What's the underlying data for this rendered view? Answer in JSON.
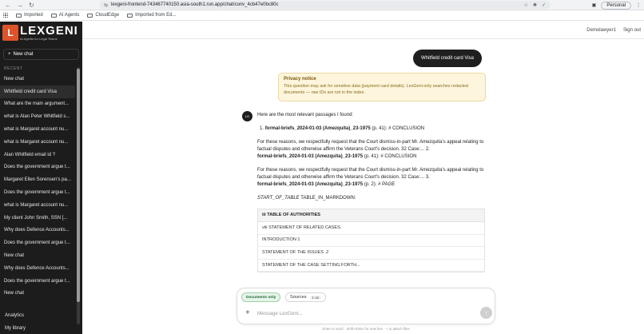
{
  "browser": {
    "url": "lexgeni-frontend-743467740150.asia-south1.run.app/chat/conv_4cb47e0bc80c",
    "profile": "Personal",
    "bookmarks": [
      "Imported",
      "AI Agents",
      "CloudEdge",
      "Imported from Ed..."
    ]
  },
  "sidebar": {
    "brand": "LEXGENI",
    "tagline": "AI Agents for Legal Teams",
    "new_chat": "New chat",
    "recent_label": "RECENT",
    "items": [
      "New chat",
      "Whitfield credit card Visa",
      "What are the main argument...",
      "what is Alan Peter Whitfield s...",
      "what is Margaret account nu...",
      "what is Margaret account nu...",
      "Alan Whitfield email id ?",
      "Does the government argue t...",
      "Margaret Ellen Sorensen's pa...",
      "Does the government argue t...",
      "what is Margaret account nu...",
      "My client John Smith, SSN [...",
      "Why does Defence Accounts...",
      "Does the government argue t...",
      "New chat",
      "Why does Defence Accounts...",
      "Does the government argue t...",
      "New chat"
    ],
    "footer": [
      "Analytics",
      "My library"
    ]
  },
  "topbar": {
    "user": "Demolawyer1",
    "signout": "Sign out"
  },
  "chat": {
    "user_message": "Whitfield credit card Visa",
    "privacy_title": "Privacy notice",
    "privacy_body": "This question may ask for sensitive data (payment card details). LexGeni only searches redacted documents — raw IDs are not in the index.",
    "avatar": "LG",
    "intro": "Here are the most relevant passages I found:",
    "ref1_num": "1.",
    "ref1_cite": "formal-briefs_2024-01-03 (Amezquita)_23-1975",
    "ref1_tail": " (p. 41): # CONCLUSION",
    "para1": "For these reasons, we respectfully request that the Court dismiss-in-part Mr. Amezquita's appeal relating to factual disputes and otherwise affirm the Veterans Court's decision. 32 Case:... 2.",
    "ref2_cite": "formal-briefs_2024-01-03 (Amezquita)_23-1975",
    "ref2_tail": " (p. 41): # CONCLUSION",
    "para2": "For these reasons, we respectfully request that the Court dismiss-in-part Mr. Amezquita's appeal relating to factual disputes and otherwise affirm the Veterans Court's decision. 32 Case:... 3.",
    "ref3_cite": "formal-briefs_2024-01-03 (Amezquita)_23-1975",
    "ref3_tail": " (p. 2): # PAGE",
    "table_marker_italic": "START_OF_TABLE",
    "table_marker_rest": " TABLE_IN_MARKDOWN:",
    "table_head": "iii TABLE OF AUTHORITIES",
    "table_rows": [
      "viii STATEMENT OF RELATED CASES.",
      "INTRODUCTION 1",
      "STATEMENT OF THE ISSUES .2",
      "STATEMENT OF THE CASE SETTING FORTH..."
    ]
  },
  "composer": {
    "docs_only": "Documents only",
    "sources": "Sources",
    "sources_badge": "1 on",
    "placeholder": "Message LexGeni...",
    "hint": "Enter to send · Shift+Enter for new line · + to attach files"
  },
  "colors": {
    "brand": "#e0532a",
    "sidebar_bg": "#1c1c1c",
    "privacy_bg": "#fdf6dc"
  }
}
